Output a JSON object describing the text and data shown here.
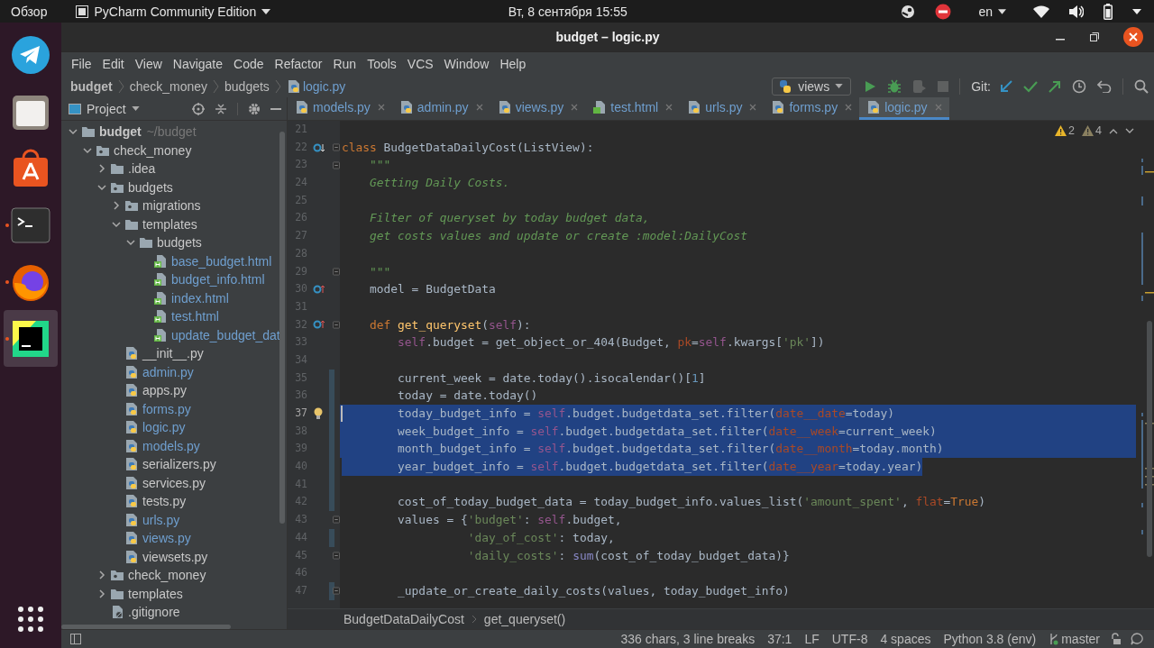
{
  "system_bar": {
    "activities": "Обзор",
    "app_menu": "PyCharm Community Edition",
    "clock": "Вт, 8 сентября  15:55",
    "keyboard_layout": "en"
  },
  "dock": [
    {
      "kind": "telegram",
      "running": false,
      "selected": false
    },
    {
      "kind": "files",
      "running": false,
      "selected": false
    },
    {
      "kind": "software",
      "running": false,
      "selected": false
    },
    {
      "kind": "terminal",
      "running": true,
      "selected": false
    },
    {
      "kind": "firefox",
      "running": true,
      "selected": false
    },
    {
      "kind": "pycharm",
      "running": true,
      "selected": true
    }
  ],
  "window": {
    "title": "budget – logic.py"
  },
  "menu": [
    "File",
    "Edit",
    "View",
    "Navigate",
    "Code",
    "Refactor",
    "Run",
    "Tools",
    "VCS",
    "Window",
    "Help"
  ],
  "breadcrumbs": [
    {
      "label": "budget",
      "kind": "project"
    },
    {
      "label": "check_money",
      "kind": "folder"
    },
    {
      "label": "budgets",
      "kind": "folder"
    },
    {
      "label": "logic.py",
      "kind": "file"
    }
  ],
  "toolbar": {
    "run_config": "views",
    "git_label": "Git:"
  },
  "project_panel": {
    "title": "Project"
  },
  "project_tree": [
    {
      "name": "budget",
      "hint": "~/budget",
      "kind": "project",
      "expanded": true,
      "children": [
        {
          "name": "check_money",
          "kind": "package",
          "expanded": true,
          "children": [
            {
              "name": ".idea",
              "kind": "folder",
              "expanded": false
            },
            {
              "name": "budgets",
              "kind": "package",
              "expanded": true,
              "children": [
                {
                  "name": "migrations",
                  "kind": "package",
                  "expanded": false
                },
                {
                  "name": "templates",
                  "kind": "folder",
                  "expanded": true,
                  "children": [
                    {
                      "name": "budgets",
                      "kind": "folder",
                      "expanded": true,
                      "children": [
                        {
                          "name": "base_budget.html",
                          "kind": "html",
                          "modified": true
                        },
                        {
                          "name": "budget_info.html",
                          "kind": "html",
                          "modified": true
                        },
                        {
                          "name": "index.html",
                          "kind": "html",
                          "modified": true
                        },
                        {
                          "name": "test.html",
                          "kind": "html",
                          "modified": true
                        },
                        {
                          "name": "update_budget_dat",
                          "kind": "html",
                          "modified": true
                        }
                      ]
                    }
                  ]
                },
                {
                  "name": "__init__.py",
                  "kind": "py",
                  "modified": false
                },
                {
                  "name": "admin.py",
                  "kind": "py",
                  "modified": true
                },
                {
                  "name": "apps.py",
                  "kind": "py",
                  "modified": false
                },
                {
                  "name": "forms.py",
                  "kind": "py",
                  "modified": true
                },
                {
                  "name": "logic.py",
                  "kind": "py",
                  "modified": true
                },
                {
                  "name": "models.py",
                  "kind": "py",
                  "modified": true
                },
                {
                  "name": "serializers.py",
                  "kind": "py",
                  "modified": false
                },
                {
                  "name": "services.py",
                  "kind": "py",
                  "modified": false
                },
                {
                  "name": "tests.py",
                  "kind": "py",
                  "modified": false
                },
                {
                  "name": "urls.py",
                  "kind": "py",
                  "modified": true
                },
                {
                  "name": "views.py",
                  "kind": "py",
                  "modified": true
                },
                {
                  "name": "viewsets.py",
                  "kind": "py",
                  "modified": false
                }
              ]
            },
            {
              "name": "check_money",
              "kind": "package",
              "expanded": false
            },
            {
              "name": "templates",
              "kind": "folder",
              "expanded": false
            },
            {
              "name": ".gitignore",
              "kind": "ignore",
              "modified": false
            }
          ]
        }
      ]
    }
  ],
  "tabs": [
    {
      "label": "models.py",
      "kind": "py",
      "selected": false
    },
    {
      "label": "admin.py",
      "kind": "py",
      "selected": false
    },
    {
      "label": "views.py",
      "kind": "py",
      "selected": false
    },
    {
      "label": "test.html",
      "kind": "html",
      "selected": false
    },
    {
      "label": "urls.py",
      "kind": "py",
      "selected": false
    },
    {
      "label": "forms.py",
      "kind": "py",
      "selected": false
    },
    {
      "label": "logic.py",
      "kind": "py",
      "selected": true
    }
  ],
  "inspections": {
    "warnings": "2",
    "weak_warnings": "4"
  },
  "code_lines": [
    {
      "number": "21"
    },
    {
      "number": "22",
      "marker": {
        "kind": "implemented"
      },
      "fold": true,
      "tokens": [
        {
          "kind": "keyword",
          "text": "class"
        },
        {
          "kind": "plain",
          "text": " BudgetDataDailyCost(ListView):"
        }
      ]
    },
    {
      "number": "23",
      "fold": true,
      "tokens": [
        {
          "kind": "docstring",
          "text": "    \"\"\""
        }
      ]
    },
    {
      "number": "24",
      "tokens": [
        {
          "kind": "docstring",
          "text": "    Getting Daily Costs."
        }
      ]
    },
    {
      "number": "25"
    },
    {
      "number": "26",
      "tokens": [
        {
          "kind": "docstring",
          "text": "    Filter of queryset by today budget data,"
        }
      ]
    },
    {
      "number": "27",
      "tokens": [
        {
          "kind": "docstring",
          "text": "    get costs values and update or create :model:DailyCost"
        }
      ]
    },
    {
      "number": "28"
    },
    {
      "number": "29",
      "fold": true,
      "tokens": [
        {
          "kind": "docstring",
          "text": "    \"\"\""
        }
      ]
    },
    {
      "number": "30",
      "marker": {
        "kind": "overrides"
      },
      "tokens": [
        {
          "kind": "plain",
          "text": "    model = BudgetData"
        }
      ]
    },
    {
      "number": "31"
    },
    {
      "number": "32",
      "marker": {
        "kind": "overrides"
      },
      "fold": true,
      "tokens": [
        {
          "kind": "keyword",
          "text": "    def "
        },
        {
          "kind": "function",
          "text": "get_queryset"
        },
        {
          "kind": "plain",
          "text": "("
        },
        {
          "kind": "self",
          "text": "self"
        },
        {
          "kind": "plain",
          "text": "):"
        }
      ]
    },
    {
      "number": "33",
      "tokens": [
        {
          "kind": "self",
          "text": "        self"
        },
        {
          "kind": "plain",
          "text": ".budget = get_object_or_404(Budget, "
        },
        {
          "kind": "parameter",
          "text": "pk"
        },
        {
          "kind": "plain",
          "text": "="
        },
        {
          "kind": "self",
          "text": "self"
        },
        {
          "kind": "plain",
          "text": ".kwargs["
        },
        {
          "kind": "string",
          "text": "'pk'"
        },
        {
          "kind": "plain",
          "text": "])"
        }
      ]
    },
    {
      "number": "34"
    },
    {
      "number": "35",
      "changed": true,
      "tokens": [
        {
          "kind": "plain",
          "text": "        current_week = date.today().isocalendar()["
        },
        {
          "kind": "number",
          "text": "1"
        },
        {
          "kind": "plain",
          "text": "]"
        }
      ]
    },
    {
      "number": "36",
      "changed": true,
      "tokens": [
        {
          "kind": "plain",
          "text": "        today = date.today()"
        }
      ]
    },
    {
      "number": "37",
      "changed": true,
      "caret": true,
      "marker": {
        "kind": "bulb"
      },
      "selected": true,
      "tokens": [
        {
          "kind": "plain",
          "text": "        today_budget_info = "
        },
        {
          "kind": "self",
          "text": "self"
        },
        {
          "kind": "plain",
          "text": ".budget.budgetdata_set.filter("
        },
        {
          "kind": "parameter",
          "text": "date__date"
        },
        {
          "kind": "plain",
          "text": "=today)"
        }
      ]
    },
    {
      "number": "38",
      "changed": true,
      "selected": true,
      "tokens": [
        {
          "kind": "plain",
          "text": "        week_budget_info = "
        },
        {
          "kind": "self",
          "text": "self"
        },
        {
          "kind": "plain",
          "text": ".budget.budgetdata_set.filter("
        },
        {
          "kind": "parameter",
          "text": "date__week"
        },
        {
          "kind": "plain",
          "text": "=current_week)"
        }
      ]
    },
    {
      "number": "39",
      "changed": true,
      "selected": true,
      "tokens": [
        {
          "kind": "plain",
          "text": "        month_budget_info = "
        },
        {
          "kind": "self",
          "text": "self"
        },
        {
          "kind": "plain",
          "text": ".budget.budgetdata_set.filter("
        },
        {
          "kind": "parameter",
          "text": "date__month"
        },
        {
          "kind": "plain",
          "text": "=today.month)"
        }
      ]
    },
    {
      "number": "40",
      "changed": true,
      "selected": true,
      "selection_ends": true,
      "tokens": [
        {
          "kind": "plain",
          "text": "        year_budget_info = "
        },
        {
          "kind": "self",
          "text": "self"
        },
        {
          "kind": "plain",
          "text": ".budget.budgetdata_set.filter("
        },
        {
          "kind": "parameter",
          "text": "date__year"
        },
        {
          "kind": "plain",
          "text": "=today.year)"
        }
      ]
    },
    {
      "number": "41",
      "changed": true
    },
    {
      "number": "42",
      "changed": true,
      "tokens": [
        {
          "kind": "plain",
          "text": "        cost_of_today_budget_data = today_budget_info.values_list("
        },
        {
          "kind": "string",
          "text": "'amount_spent'"
        },
        {
          "kind": "plain",
          "text": ", "
        },
        {
          "kind": "parameter",
          "text": "flat"
        },
        {
          "kind": "plain",
          "text": "="
        },
        {
          "kind": "keyword",
          "text": "True"
        },
        {
          "kind": "plain",
          "text": ")"
        }
      ]
    },
    {
      "number": "43",
      "fold": true,
      "tokens": [
        {
          "kind": "plain",
          "text": "        values = {"
        },
        {
          "kind": "string",
          "text": "'budget'"
        },
        {
          "kind": "plain",
          "text": ": "
        },
        {
          "kind": "self",
          "text": "self"
        },
        {
          "kind": "plain",
          "text": ".budget,"
        }
      ]
    },
    {
      "number": "44",
      "changed": true,
      "tokens": [
        {
          "kind": "string",
          "text": "                  'day_of_cost'"
        },
        {
          "kind": "plain",
          "text": ": today,"
        }
      ]
    },
    {
      "number": "45",
      "fold": true,
      "tokens": [
        {
          "kind": "string",
          "text": "                  'daily_costs'"
        },
        {
          "kind": "plain",
          "text": ": "
        },
        {
          "kind": "builtin",
          "text": "sum"
        },
        {
          "kind": "plain",
          "text": "(cost_of_today_budget_data)}"
        }
      ]
    },
    {
      "number": "46"
    },
    {
      "number": "47",
      "changed": true,
      "fold": true,
      "tokens": [
        {
          "kind": "plain",
          "text": "        _update_or_create_daily_costs(values, today_budget_info)"
        }
      ]
    }
  ],
  "code_breadcrumbs": [
    "BudgetDataDailyCost",
    "get_queryset()"
  ],
  "status_bar": {
    "selection": "336 chars, 3 line breaks",
    "position": "37:1",
    "line_separator": "LF",
    "encoding": "UTF-8",
    "indent": "4 spaces",
    "interpreter": "Python 3.8 (env)",
    "branch": "master"
  }
}
